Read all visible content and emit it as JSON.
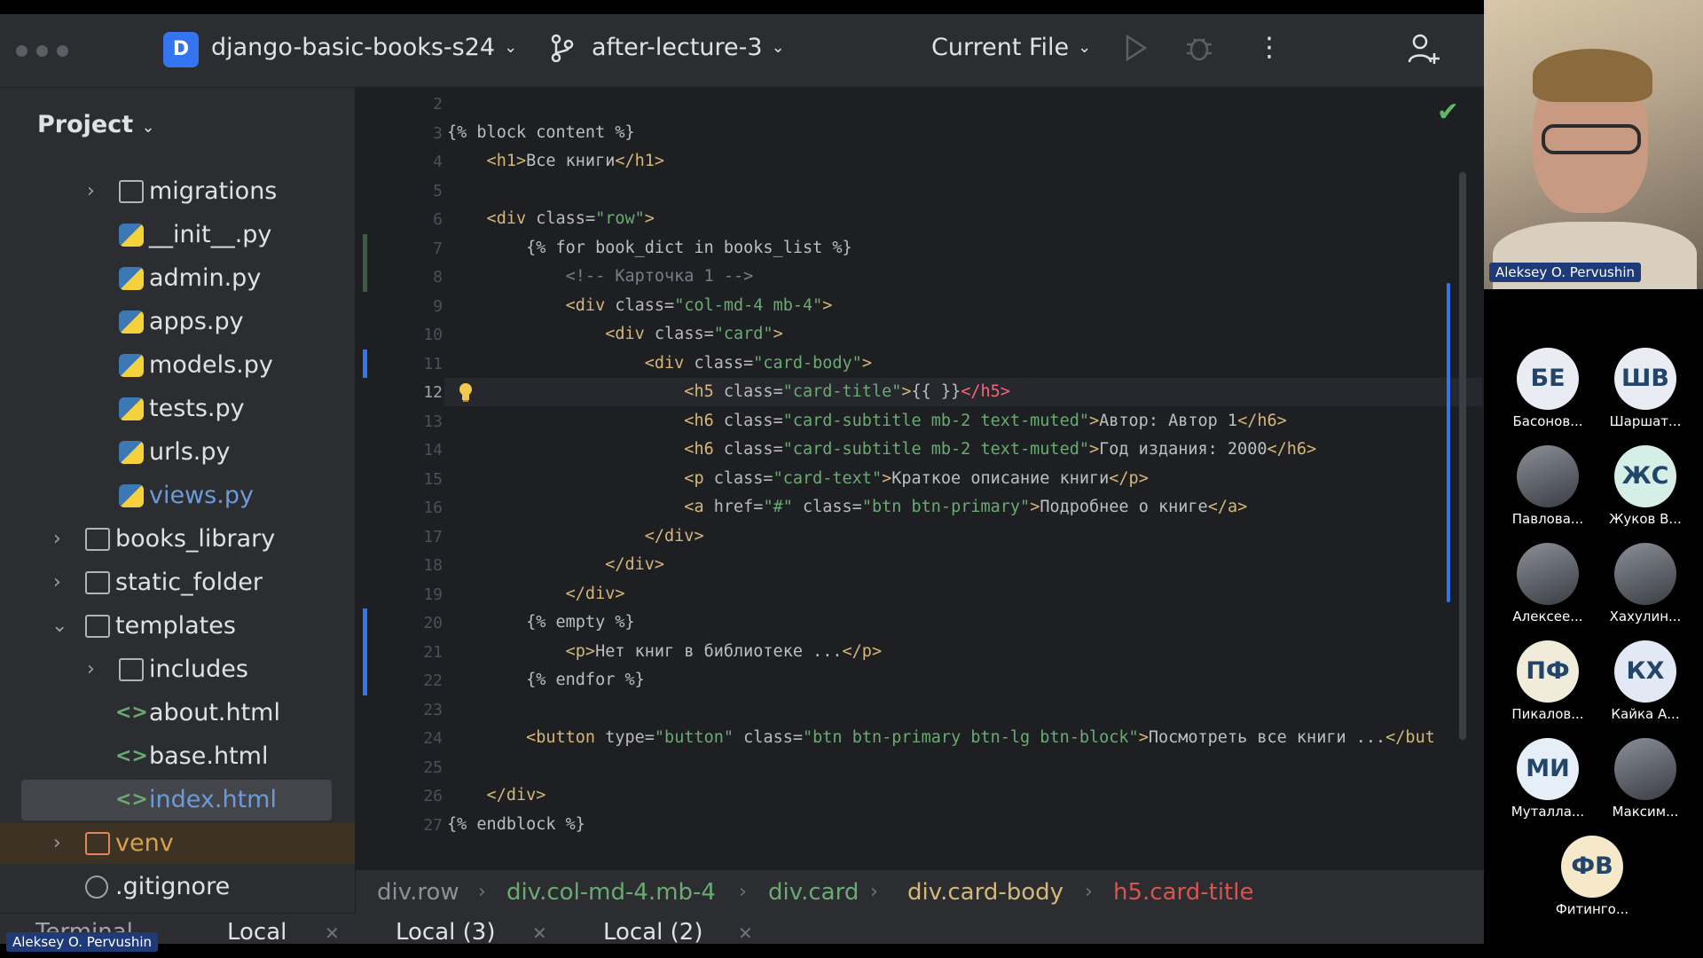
{
  "window": {
    "project_badge": "D",
    "project_name": "django-basic-books-s24",
    "branch": "after-lecture-3",
    "run_config": "Current File"
  },
  "sidebar": {
    "header": "Project",
    "items": [
      {
        "label": "migrations",
        "type": "folder",
        "expanded": false
      },
      {
        "label": "__init__.py",
        "type": "python"
      },
      {
        "label": "admin.py",
        "type": "python"
      },
      {
        "label": "apps.py",
        "type": "python"
      },
      {
        "label": "models.py",
        "type": "python"
      },
      {
        "label": "tests.py",
        "type": "python"
      },
      {
        "label": "urls.py",
        "type": "python"
      },
      {
        "label": "views.py",
        "type": "python"
      },
      {
        "label": "books_library",
        "type": "folder",
        "expanded": false
      },
      {
        "label": "static_folder",
        "type": "folder",
        "expanded": false
      },
      {
        "label": "templates",
        "type": "folder",
        "expanded": true
      },
      {
        "label": "includes",
        "type": "folder",
        "expanded": false
      },
      {
        "label": "about.html",
        "type": "html"
      },
      {
        "label": "base.html",
        "type": "html"
      },
      {
        "label": "index.html",
        "type": "html",
        "selected": true
      },
      {
        "label": "venv",
        "type": "folder",
        "expanded": false
      },
      {
        "label": ".gitignore",
        "type": "ignore"
      }
    ]
  },
  "editor": {
    "current_line": 12,
    "lines": [
      {
        "n": "2",
        "tokens": []
      },
      {
        "n": "3",
        "tokens": [
          [
            "tpl",
            "{% block content %}"
          ]
        ]
      },
      {
        "n": "4",
        "tokens": [
          [
            "tag",
            "    <h1>"
          ],
          [
            "txt",
            "Все книги"
          ],
          [
            "tag",
            "</h1>"
          ]
        ]
      },
      {
        "n": "5",
        "tokens": []
      },
      {
        "n": "6",
        "tokens": [
          [
            "tag",
            "    <div "
          ],
          [
            "attr",
            "class="
          ],
          [
            "str",
            "\"row\""
          ],
          [
            "tag",
            ">"
          ]
        ]
      },
      {
        "n": "7",
        "tokens": [
          [
            "tpl",
            "        {% for book_dict in books_list %}"
          ]
        ]
      },
      {
        "n": "8",
        "tokens": [
          [
            "cmt",
            "            <!-- Карточка 1 -->"
          ]
        ]
      },
      {
        "n": "9",
        "tokens": [
          [
            "tag",
            "            <div "
          ],
          [
            "attr",
            "class="
          ],
          [
            "str",
            "\"col-md-4 mb-4\""
          ],
          [
            "tag",
            ">"
          ]
        ]
      },
      {
        "n": "10",
        "tokens": [
          [
            "tag",
            "                <div "
          ],
          [
            "attr",
            "class="
          ],
          [
            "str",
            "\"card\""
          ],
          [
            "tag",
            ">"
          ]
        ]
      },
      {
        "n": "11",
        "tokens": [
          [
            "tag",
            "                    <div "
          ],
          [
            "attr",
            "class="
          ],
          [
            "str",
            "\"card-body\""
          ],
          [
            "tag",
            ">"
          ]
        ]
      },
      {
        "n": "12",
        "tokens": [
          [
            "tag",
            "                        <h5 "
          ],
          [
            "attr",
            "class="
          ],
          [
            "str",
            "\"card-title\""
          ],
          [
            "tag",
            ">"
          ],
          [
            "tpl",
            "{{ }}"
          ],
          [
            "err",
            "</h5>"
          ]
        ]
      },
      {
        "n": "13",
        "tokens": [
          [
            "tag",
            "                        <h6 "
          ],
          [
            "attr",
            "class="
          ],
          [
            "str",
            "\"card-subtitle mb-2 text-muted\""
          ],
          [
            "tag",
            ">"
          ],
          [
            "txt",
            "Автор: Автор 1"
          ],
          [
            "tag",
            "</h6>"
          ]
        ]
      },
      {
        "n": "14",
        "tokens": [
          [
            "tag",
            "                        <h6 "
          ],
          [
            "attr",
            "class="
          ],
          [
            "str",
            "\"card-subtitle mb-2 text-muted\""
          ],
          [
            "tag",
            ">"
          ],
          [
            "txt",
            "Год издания: 2000"
          ],
          [
            "tag",
            "</h6>"
          ]
        ]
      },
      {
        "n": "15",
        "tokens": [
          [
            "tag",
            "                        <p "
          ],
          [
            "attr",
            "class="
          ],
          [
            "str",
            "\"card-text\""
          ],
          [
            "tag",
            ">"
          ],
          [
            "txt",
            "Краткое описание книги"
          ],
          [
            "tag",
            "</p>"
          ]
        ]
      },
      {
        "n": "16",
        "tokens": [
          [
            "tag",
            "                        <a "
          ],
          [
            "attr",
            "href="
          ],
          [
            "str",
            "\"#\""
          ],
          [
            "attr",
            " class="
          ],
          [
            "str",
            "\"btn btn-primary\""
          ],
          [
            "tag",
            ">"
          ],
          [
            "txt",
            "Подробнее о книге"
          ],
          [
            "tag",
            "</a>"
          ]
        ]
      },
      {
        "n": "17",
        "tokens": [
          [
            "tag",
            "                    </div>"
          ]
        ]
      },
      {
        "n": "18",
        "tokens": [
          [
            "tag",
            "                </div>"
          ]
        ]
      },
      {
        "n": "19",
        "tokens": [
          [
            "tag",
            "            </div>"
          ]
        ]
      },
      {
        "n": "20",
        "tokens": [
          [
            "tpl",
            "        {% empty %}"
          ]
        ]
      },
      {
        "n": "21",
        "tokens": [
          [
            "tag",
            "            <p>"
          ],
          [
            "txt",
            "Нет книг в библиотеке ..."
          ],
          [
            "tag",
            "</p>"
          ]
        ]
      },
      {
        "n": "22",
        "tokens": [
          [
            "tpl",
            "        {% endfor %}"
          ]
        ]
      },
      {
        "n": "23",
        "tokens": []
      },
      {
        "n": "24",
        "tokens": [
          [
            "tag",
            "        <button "
          ],
          [
            "attr",
            "type="
          ],
          [
            "str",
            "\"button\""
          ],
          [
            "attr",
            " class="
          ],
          [
            "str",
            "\"btn btn-primary btn-lg btn-block\""
          ],
          [
            "tag",
            ">"
          ],
          [
            "txt",
            "Посмотреть все книги ..."
          ],
          [
            "tag",
            "</but"
          ]
        ]
      },
      {
        "n": "25",
        "tokens": []
      },
      {
        "n": "26",
        "tokens": [
          [
            "tag",
            "    </div>"
          ]
        ]
      },
      {
        "n": "27",
        "tokens": [
          [
            "tpl",
            "{% endblock %}"
          ]
        ]
      }
    ]
  },
  "breadcrumbs": [
    {
      "label": "div.row",
      "color": "#8c8f96"
    },
    {
      "label": "div.col-md-4.mb-4",
      "color": "#6aab73"
    },
    {
      "label": "div.card",
      "color": "#6aab73"
    },
    {
      "label": "div.card-body",
      "color": "#d5b778"
    },
    {
      "label": "h5.card-title",
      "color": "#d9534f"
    }
  ],
  "bottom_tabs": [
    {
      "label": "Terminal"
    },
    {
      "label": "Local"
    },
    {
      "label": "Local (3)"
    },
    {
      "label": "Local (2)"
    }
  ],
  "presenter_name": "Aleksey O. Pervushin",
  "participants": [
    {
      "initials": "БЕ",
      "name": "Басонов...",
      "bg": "#e9edf3"
    },
    {
      "initials": "ШВ",
      "name": "Шаршат...",
      "bg": "#e9edf3"
    },
    {
      "initials": "",
      "name": "Павлова...",
      "bg": "#c7d3ea",
      "photo": true
    },
    {
      "initials": "ЖС",
      "name": "Жуков В...",
      "bg": "#d5efe7"
    },
    {
      "initials": "",
      "name": "Алексее...",
      "bg": "#6f86a8",
      "photo": true
    },
    {
      "initials": "",
      "name": "Хахулин...",
      "bg": "#8d8d8d",
      "photo": true
    },
    {
      "initials": "ПФ",
      "name": "Пикалов...",
      "bg": "#f0ecd9"
    },
    {
      "initials": "КХ",
      "name": "Кайка А...",
      "bg": "#e3e8f5"
    },
    {
      "initials": "МИ",
      "name": "Муталла...",
      "bg": "#e6eef8"
    },
    {
      "initials": "",
      "name": "Максим...",
      "bg": "#7b6e66",
      "photo": true
    },
    {
      "initials": "ФВ",
      "name": "Фитинго...",
      "bg": "#f6e9c9"
    }
  ]
}
